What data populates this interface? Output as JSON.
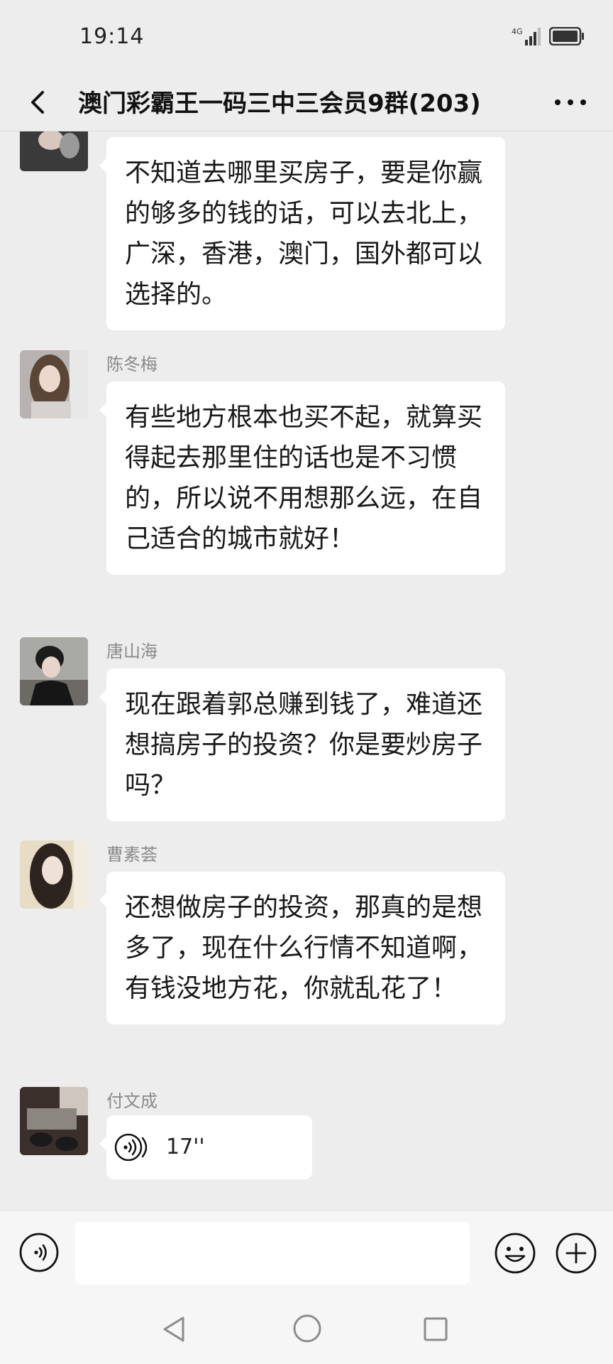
{
  "status_bar": {
    "time": "19:14",
    "network": "4G"
  },
  "header": {
    "title": "澳门彩霸王一码三中三会员9群(203)"
  },
  "messages": [
    {
      "sender": "",
      "text": "不知道去哪里买房子，要是你赢的够多的钱的话，可以去北上，广深，香港，澳门，国外都可以选择的。"
    },
    {
      "sender": "陈冬梅",
      "text": "有些地方根本也买不起，就算买得起去那里住的话也是不习惯的，所以说不用想那么远，在自己适合的城市就好！"
    },
    {
      "sender": "唐山海",
      "text": "现在跟着郭总赚到钱了，难道还想搞房子的投资？你是要炒房子吗？"
    },
    {
      "sender": "曹素荟",
      "text": "还想做房子的投资，那真的是想多了，现在什么行情不知道啊，有钱没地方花，你就乱花了！"
    },
    {
      "sender": "付文成",
      "voice_duration": "17''"
    }
  ],
  "colors": {
    "background": "#ededed",
    "bubble": "#ffffff",
    "sender_name": "#8a8a8a"
  },
  "icons": [
    "back-arrow-icon",
    "more-icon",
    "voice-icon",
    "emoji-icon",
    "plus-icon",
    "sys-back-icon",
    "sys-home-icon",
    "sys-recent-icon"
  ]
}
